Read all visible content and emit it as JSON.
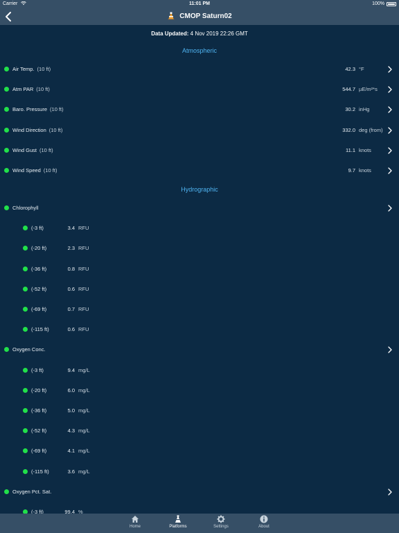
{
  "status": {
    "carrier": "Carrier",
    "time": "11:01 PM",
    "battery": "100%"
  },
  "nav": {
    "title": "CMOP Saturn02"
  },
  "updated": {
    "label": "Data Updated:",
    "value": "4 Nov 2019 22:26 GMT"
  },
  "sections": {
    "atmospheric": "Atmospheric",
    "hydrographic": "Hydrographic"
  },
  "atmospheric": [
    {
      "name": "Air Temp.",
      "height": "(10 ft)",
      "value": "42.3",
      "unit": "°F"
    },
    {
      "name": "Atm PAR",
      "height": "(10 ft)",
      "value": "544.7",
      "unit": "µE/m²*s"
    },
    {
      "name": "Baro. Pressure",
      "height": "(10 ft)",
      "value": "30.2",
      "unit": "inHg"
    },
    {
      "name": "Wind Direction",
      "height": "(10 ft)",
      "value": "332.0",
      "unit": "deg (from)"
    },
    {
      "name": "Wind Gust",
      "height": "(10 ft)",
      "value": "11.1",
      "unit": "knots"
    },
    {
      "name": "Wind Speed",
      "height": "(10 ft)",
      "value": "9.7",
      "unit": "knots"
    }
  ],
  "hydro": {
    "chlorophyll": {
      "name": "Chlorophyll",
      "rows": [
        {
          "depth": "(-3 ft)",
          "value": "3.4",
          "unit": "RFU"
        },
        {
          "depth": "(-20 ft)",
          "value": "2.3",
          "unit": "RFU"
        },
        {
          "depth": "(-36 ft)",
          "value": "0.8",
          "unit": "RFU"
        },
        {
          "depth": "(-52 ft)",
          "value": "0.6",
          "unit": "RFU"
        },
        {
          "depth": "(-69 ft)",
          "value": "0.7",
          "unit": "RFU"
        },
        {
          "depth": "(-115 ft)",
          "value": "0.6",
          "unit": "RFU"
        }
      ]
    },
    "oxygen": {
      "name": "Oxygen Conc.",
      "rows": [
        {
          "depth": "(-3 ft)",
          "value": "9.4",
          "unit": "mg/L"
        },
        {
          "depth": "(-20 ft)",
          "value": "6.0",
          "unit": "mg/L"
        },
        {
          "depth": "(-36 ft)",
          "value": "5.0",
          "unit": "mg/L"
        },
        {
          "depth": "(-52 ft)",
          "value": "4.3",
          "unit": "mg/L"
        },
        {
          "depth": "(-69 ft)",
          "value": "4.1",
          "unit": "mg/L"
        },
        {
          "depth": "(-115 ft)",
          "value": "3.6",
          "unit": "mg/L"
        }
      ]
    },
    "oxygen_sat": {
      "name": "Oxygen Pct. Sat.",
      "rows": [
        {
          "depth": "(-3 ft)",
          "value": "99.4",
          "unit": "%"
        }
      ]
    }
  },
  "tabs": [
    {
      "label": "Home",
      "icon": "home-icon"
    },
    {
      "label": "Platforms",
      "icon": "platform-icon"
    },
    {
      "label": "Settings",
      "icon": "gear-icon"
    },
    {
      "label": "About",
      "icon": "info-icon"
    }
  ],
  "colors": {
    "background": "#0c2a44",
    "bars": "#364f66",
    "accent": "#4fb3f0",
    "status_ok": "#21e04a"
  }
}
